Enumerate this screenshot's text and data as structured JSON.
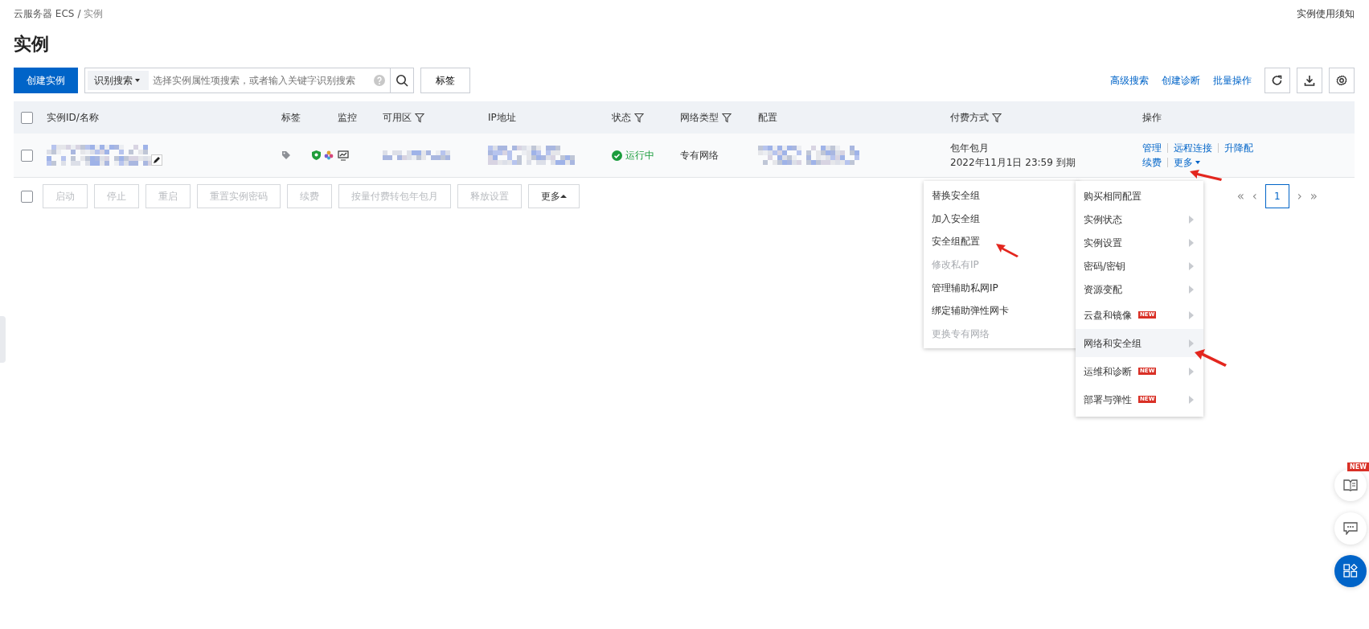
{
  "breadcrumb": {
    "items": [
      {
        "label": "云服务器 ECS"
      },
      {
        "label": "实例"
      }
    ],
    "separator": "/"
  },
  "notice_link": "实例使用须知",
  "title": "实例",
  "toolbar": {
    "create_button": "创建实例",
    "search": {
      "scope": "识别搜索",
      "placeholder": "选择实例属性项搜索，或者输入关键字识别搜索"
    },
    "tag_button": "标签",
    "links": [
      "高级搜索",
      "创建诊断",
      "批量操作"
    ]
  },
  "table": {
    "select_all_checked": false,
    "columns": [
      {
        "label": "实例ID/名称",
        "filter": false
      },
      {
        "label": "标签",
        "filter": false
      },
      {
        "label": "监控",
        "filter": false
      },
      {
        "label": "可用区",
        "filter": true
      },
      {
        "label": "IP地址",
        "filter": false
      },
      {
        "label": "状态",
        "filter": true
      },
      {
        "label": "网络类型",
        "filter": true
      },
      {
        "label": "配置",
        "filter": false
      },
      {
        "label": "付费方式",
        "filter": true
      },
      {
        "label": "操作",
        "filter": false
      }
    ],
    "rows": [
      {
        "checked": false,
        "status": "运行中",
        "network": "专有网络",
        "billing": "包年包月",
        "expiry": "2022年11月1日 23:59 到期",
        "actions": [
          "管理",
          "远程连接",
          "升降配",
          "续费",
          "更多"
        ]
      }
    ]
  },
  "bulk_select_all_checked": false,
  "bulk_actions": [
    {
      "label": "启动",
      "disabled": true
    },
    {
      "label": "停止",
      "disabled": true
    },
    {
      "label": "重启",
      "disabled": true
    },
    {
      "label": "重置实例密码",
      "disabled": true
    },
    {
      "label": "续费",
      "disabled": true
    },
    {
      "label": "按量付费转包年包月",
      "disabled": true
    },
    {
      "label": "释放设置",
      "disabled": true
    },
    {
      "label": "更多",
      "disabled": false
    }
  ],
  "pagination": {
    "first": "«",
    "previous": "‹",
    "next": "›",
    "last": "»",
    "pages": [
      {
        "label": "1",
        "selected": true
      }
    ]
  },
  "more_menu": [
    {
      "label": "购买相同配置",
      "submenu": false,
      "highlighted": false
    },
    {
      "label": "实例状态",
      "submenu": true,
      "highlighted": false
    },
    {
      "label": "实例设置",
      "submenu": true,
      "highlighted": false
    },
    {
      "label": "密码/密钥",
      "submenu": true,
      "highlighted": false
    },
    {
      "label": "资源变配",
      "submenu": true,
      "highlighted": false
    },
    {
      "label": "云盘和镜像",
      "submenu": true,
      "highlighted": false,
      "badge": "NEW"
    },
    {
      "label": "网络和安全组",
      "submenu": true,
      "highlighted": true
    },
    {
      "label": "运维和诊断",
      "submenu": true,
      "highlighted": false,
      "badge": "NEW"
    },
    {
      "label": "部署与弹性",
      "submenu": true,
      "highlighted": false,
      "badge": "NEW"
    }
  ],
  "security_submenu": [
    {
      "label": "替换安全组",
      "disabled": false
    },
    {
      "label": "加入安全组",
      "disabled": false
    },
    {
      "label": "安全组配置",
      "disabled": false
    },
    {
      "label": "修改私有IP",
      "disabled": true
    },
    {
      "label": "管理辅助私网IP",
      "disabled": false
    },
    {
      "label": "绑定辅助弹性网卡",
      "disabled": false
    },
    {
      "label": "更换专有网络",
      "disabled": true
    }
  ],
  "float_buttons": [
    {
      "kind": "guide",
      "badge": "NEW"
    },
    {
      "kind": "feedback"
    },
    {
      "kind": "apps"
    }
  ]
}
